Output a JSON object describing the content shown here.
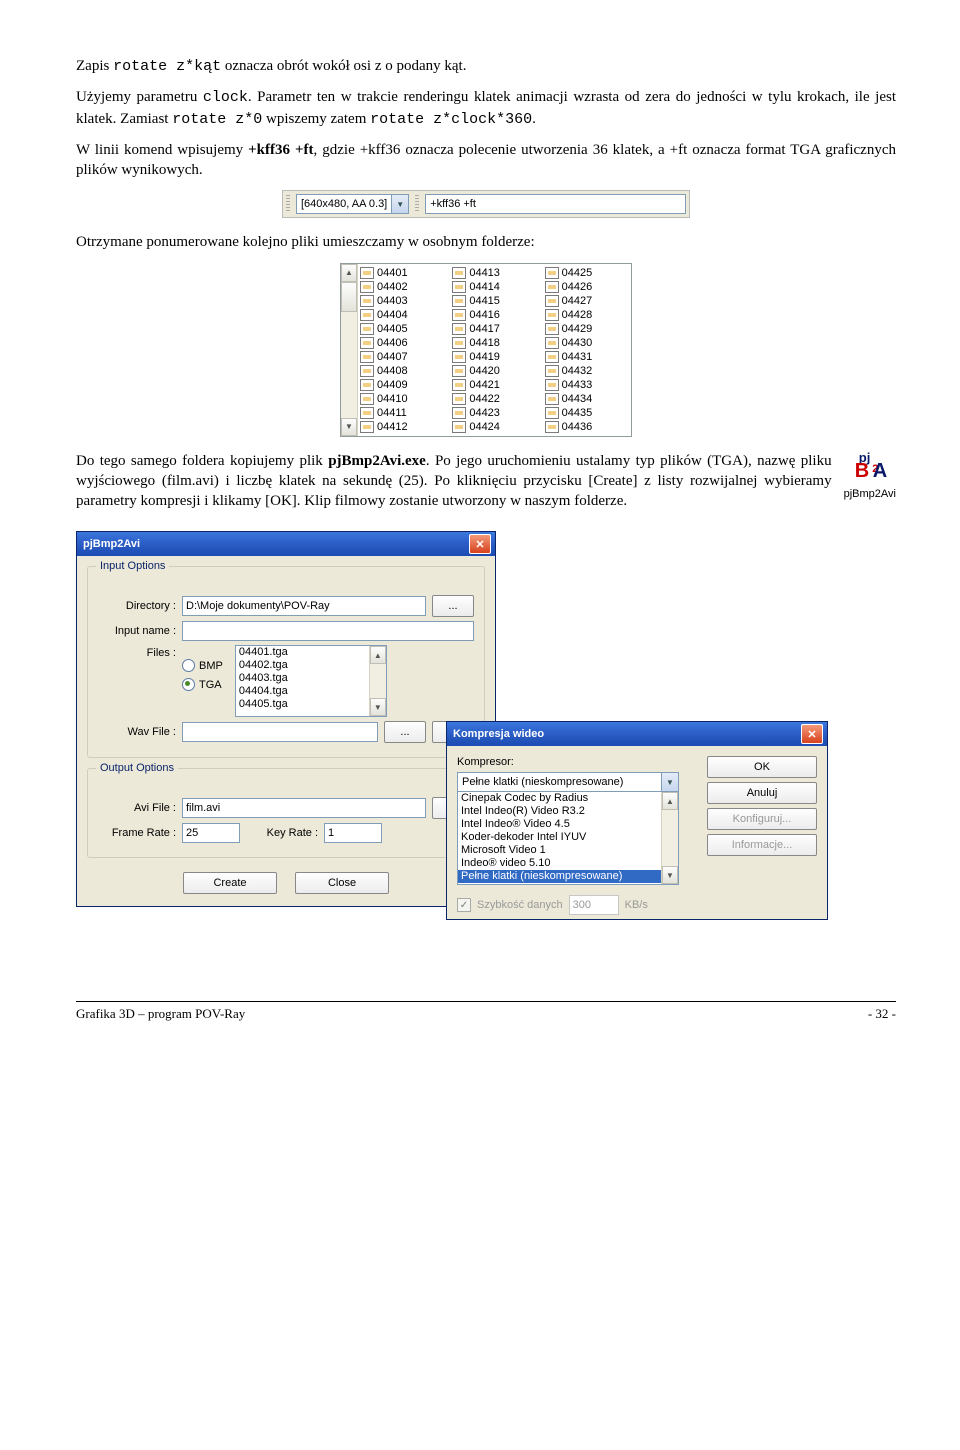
{
  "para1": {
    "pre": "Zapis ",
    "code": "rotate z*kąt",
    "post": " oznacza obrót wokół osi z o podany kąt."
  },
  "para2": {
    "t1": "Użyjemy parametru ",
    "c1": "clock",
    "t2": ". Parametr ten w trakcie renderingu klatek animacji wzrasta od zera do jedności w tylu krokach, ile jest klatek. Zamiast ",
    "c2": "rotate z*0",
    "t3": " wpiszemy zatem ",
    "c3": "rotate z*clock*360",
    "t4": "."
  },
  "para3": "W linii komend wpisujemy +kff36 +ft, gdzie +kff36 oznacza polecenie utworzenia 36 klatek, a +ft oznacza format TGA graficznych plików wynikowych.",
  "para3_bold1": "+kff36 +ft",
  "toolbar": {
    "combo": "[640x480, AA 0.3]",
    "cmd": "+kff36 +ft"
  },
  "para4": "Otrzymane ponumerowane kolejno pliki umieszczamy w osobnym folderze:",
  "files": {
    "col1": [
      "04401",
      "04402",
      "04403",
      "04404",
      "04405",
      "04406",
      "04407",
      "04408",
      "04409",
      "04410",
      "04411",
      "04412"
    ],
    "col2": [
      "04413",
      "04414",
      "04415",
      "04416",
      "04417",
      "04418",
      "04419",
      "04420",
      "04421",
      "04422",
      "04423",
      "04424"
    ],
    "col3": [
      "04425",
      "04426",
      "04427",
      "04428",
      "04429",
      "04430",
      "04431",
      "04432",
      "04433",
      "04434",
      "04435",
      "04436"
    ]
  },
  "p2a_label": "pjBmp2Avi",
  "para5": {
    "t1": "Do tego samego foldera kopiujemy plik ",
    "b1": "pjBmp2Avi.exe",
    "t2": ". Po jego uruchomieniu ustalamy typ plików (TGA), nazwę pliku wyjściowego (film.avi) i liczbę klatek na sekundę (25). Po kliknięciu przycisku [Create] z listy rozwijalnej wybieramy parametry kompresji i klikamy [OK]. Klip filmowy zostanie utworzony w naszym folderze."
  },
  "dlg1": {
    "title": "pjBmp2Avi",
    "grp1": "Input Options",
    "directory_lbl": "Directory :",
    "directory_val": "D:\\Moje dokumenty\\POV-Ray",
    "inputname_lbl": "Input name :",
    "inputname_val": "",
    "files_lbl": "Files :",
    "bmp": "BMP",
    "tga": "TGA",
    "file_list": [
      "04401.tga",
      "04402.tga",
      "04403.tga",
      "04404.tga",
      "04405.tga"
    ],
    "wav_lbl": "Wav File :",
    "wav_val": "",
    "btn_dots": "...",
    "btn_gt": ">",
    "grp2": "Output Options",
    "avi_lbl": "Avi File :",
    "avi_val": "film.avi",
    "frame_lbl": "Frame Rate :",
    "frame_val": "25",
    "key_lbl": "Key Rate :",
    "key_val": "1",
    "create": "Create",
    "close": "Close"
  },
  "dlg2": {
    "title": "Kompresja wideo",
    "kompresor_lbl": "Kompresor:",
    "combo_val": "Pełne klatki (nieskompresowane)",
    "list": [
      "Cinepak Codec by Radius",
      "Intel Indeo(R) Video R3.2",
      "Intel Indeo® Video 4.5",
      "Koder-dekoder Intel IYUV",
      "Microsoft Video 1",
      "Indeo® video 5.10",
      "Pełne klatki (nieskompresowane)"
    ],
    "ok": "OK",
    "anuluj": "Anuluj",
    "konfig": "Konfiguruj...",
    "info": "Informacje...",
    "szyb": "Szybkość danych",
    "szyb_val": "300",
    "szyb_unit": "KB/s"
  },
  "footer_left": "Grafika 3D – program POV-Ray",
  "footer_right": "- 32 -"
}
